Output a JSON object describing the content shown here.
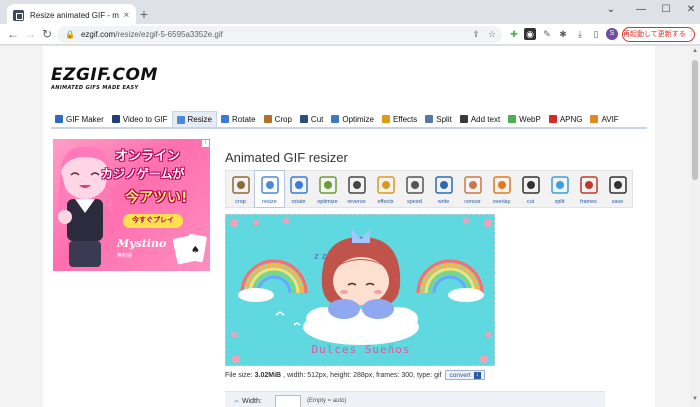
{
  "browser": {
    "tab_title": "Resize animated GIF - magic-dru...",
    "tab_close": "×",
    "new_tab": "+",
    "url_host": "ezgif.com",
    "url_path": "/resize/ezgif-5-6595a3352e.gif",
    "profile_initial": "S",
    "relaunch_label": "再起動して更新する",
    "relaunch_menu": "⋮",
    "window": {
      "chevron": "⌄",
      "minimize": "—",
      "maximize": "☐",
      "close": "✕"
    }
  },
  "logo": {
    "main": "EZGIF.COM",
    "sub": "ANIMATED GIFS MADE EASY"
  },
  "nav": {
    "items": [
      {
        "label": "GIF Maker",
        "color": "#2d6cc0"
      },
      {
        "label": "Video to GIF",
        "color": "#1f3f7a"
      },
      {
        "label": "Resize",
        "color": "#4a8ad6",
        "active": true
      },
      {
        "label": "Rotate",
        "color": "#3a7bd5"
      },
      {
        "label": "Crop",
        "color": "#b0702a"
      },
      {
        "label": "Cut",
        "color": "#2b4d80"
      },
      {
        "label": "Optimize",
        "color": "#3d7ac0"
      },
      {
        "label": "Effects",
        "color": "#d99b1a"
      },
      {
        "label": "Split",
        "color": "#5677a8"
      },
      {
        "label": "Add text",
        "color": "#3a3a3a"
      },
      {
        "label": "WebP",
        "color": "#4caf50"
      },
      {
        "label": "APNG",
        "color": "#d42b2b"
      },
      {
        "label": "AVIF",
        "color": "#e08a1e"
      }
    ]
  },
  "ad": {
    "line1": "オンライン",
    "line2": "カジノゲームが",
    "line3": "今アツい!",
    "cta": "今すぐプレイ",
    "brand": "Mystino",
    "brand_sub": "無料版",
    "info": "i"
  },
  "page": {
    "title": "Animated GIF resizer",
    "tools": [
      {
        "label": "crop",
        "color": "#8a6d3b"
      },
      {
        "label": "resize",
        "color": "#4a8ad6",
        "active": true
      },
      {
        "label": "rotate",
        "color": "#3a7bd5"
      },
      {
        "label": "optimize",
        "color": "#6a9c3a"
      },
      {
        "label": "reverse",
        "color": "#444444"
      },
      {
        "label": "effects",
        "color": "#d99b1a"
      },
      {
        "label": "speed",
        "color": "#555555"
      },
      {
        "label": "write",
        "color": "#2b6cb0"
      },
      {
        "label": "censor",
        "color": "#c47a4a"
      },
      {
        "label": "overlay",
        "color": "#e07b1e"
      },
      {
        "label": "cut",
        "color": "#333333"
      },
      {
        "label": "split",
        "color": "#3aa0d8"
      },
      {
        "label": "frames",
        "color": "#c0392b"
      },
      {
        "label": "save",
        "color": "#333333"
      }
    ],
    "gif_caption": "Dulces Sueños",
    "file_info": {
      "prefix": "File size:",
      "size": "3.02MiB",
      "rest": ", width: 512px, height: 288px, frames: 300, type: gif",
      "convert_label": "convert",
      "convert_icon": "↓"
    },
    "form": {
      "width_label": "Width:",
      "width_value": "",
      "width_hint": "(Empty = auto)"
    }
  }
}
